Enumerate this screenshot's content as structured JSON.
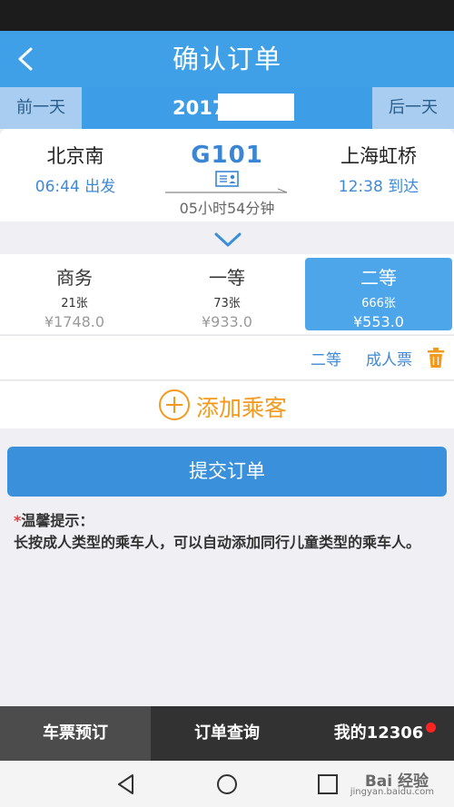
{
  "header": {
    "title": "确认订单",
    "back_icon": "chevron-left-icon"
  },
  "date_bar": {
    "prev_label": "前一天",
    "date_text": "2017",
    "next_label": "后一天"
  },
  "train": {
    "from_station": "北京南",
    "depart_time": "06:44 出发",
    "train_number": "G101",
    "duration": "05小时54分钟",
    "to_station": "上海虹桥",
    "arrive_time": "12:38 到达"
  },
  "seats": [
    {
      "class": "商务",
      "count": "21张",
      "price": "¥1748.0",
      "selected": false
    },
    {
      "class": "一等",
      "count": "73张",
      "price": "¥933.0",
      "selected": false
    },
    {
      "class": "二等",
      "count": "666张",
      "price": "¥553.0",
      "selected": true
    }
  ],
  "passenger": {
    "seat_class": "二等",
    "ticket_type": "成人票"
  },
  "add_passenger": {
    "label": "添加乘客"
  },
  "submit": {
    "label": "提交订单"
  },
  "tip": {
    "star": "*",
    "title": "温馨提示：",
    "body": "长按成人类型的乘车人，可以自动添加同行儿童类型的乘车人。"
  },
  "tabs": [
    {
      "label": "车票预订",
      "active": true
    },
    {
      "label": "订单查询",
      "active": false
    },
    {
      "label": "我的12306",
      "active": false
    }
  ],
  "watermark": {
    "text": "Bai 经验",
    "sub": "jingyan.baidu.com"
  },
  "colors": {
    "primary": "#3fa0e8",
    "selected_seat": "#4ea6ea",
    "accent_orange": "#f39a1e",
    "link_blue": "#3e8ad8",
    "badge_red": "#ff2222"
  }
}
